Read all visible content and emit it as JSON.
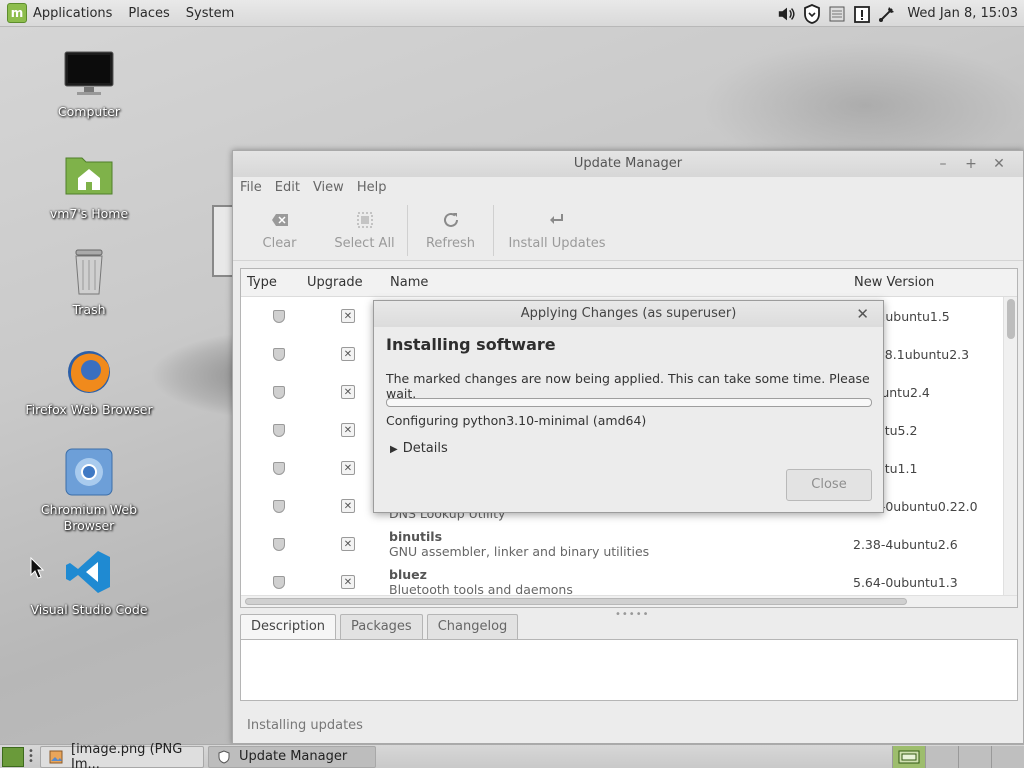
{
  "top_panel": {
    "menus": [
      "Applications",
      "Places",
      "System"
    ],
    "clock": "Wed Jan  8, 15:03",
    "tray_icons": [
      "volume-icon",
      "shield-update-icon",
      "keyboard-icon",
      "notification-icon",
      "network-icon"
    ]
  },
  "desktop": {
    "icons": [
      {
        "label": "Computer",
        "icon": "monitor-icon"
      },
      {
        "label": "vm7's Home",
        "icon": "home-folder-icon"
      },
      {
        "label": "Trash",
        "icon": "trash-icon"
      },
      {
        "label": "Firefox Web Browser",
        "icon": "firefox-icon"
      },
      {
        "label": "Chromium Web Browser",
        "icon": "chromium-icon"
      },
      {
        "label": "Visual Studio Code",
        "icon": "vscode-icon"
      }
    ]
  },
  "window": {
    "title": "Update Manager",
    "menu": [
      "File",
      "Edit",
      "View",
      "Help"
    ],
    "toolbar": {
      "clear": "Clear",
      "select_all": "Select All",
      "refresh": "Refresh",
      "install": "Install Updates"
    },
    "columns": {
      "type": "Type",
      "upgrade": "Upgrade",
      "name": "Name",
      "version": "New Version"
    },
    "rows": [
      {
        "name": "",
        "desc": "",
        "version": "7.5-2ubuntu1.5"
      },
      {
        "name": "",
        "desc": "",
        "version": "91218.1ubuntu2.3"
      },
      {
        "name": "",
        "desc": "",
        "version": "-2ubuntu2.4"
      },
      {
        "name": "",
        "desc": "",
        "version": "ubuntu5.2"
      },
      {
        "name": "",
        "desc": "",
        "version": "ubuntu1.1"
      },
      {
        "name": "",
        "desc": "DNS Lookup Utility",
        "version": "8.28-0ubuntu0.22.0"
      },
      {
        "name": "binutils",
        "desc": "GNU assembler, linker and binary utilities",
        "version": "2.38-4ubuntu2.6"
      },
      {
        "name": "bluez",
        "desc": "Bluetooth tools and daemons",
        "version": "5.64-0ubuntu1.3"
      }
    ],
    "tabs": [
      "Description",
      "Packages",
      "Changelog"
    ],
    "status": "Installing updates"
  },
  "dialog": {
    "title": "Applying Changes (as superuser)",
    "heading": "Installing software",
    "message": "The marked changes are now being applied. This can take some time. Please wait.",
    "progress": 0.0,
    "configuring": "Configuring python3.10-minimal (amd64)",
    "details": "Details",
    "close_button": "Close"
  },
  "taskbar": {
    "tasks": [
      "[image.png (PNG Im...",
      "Update Manager"
    ],
    "workspaces": 4
  },
  "colors": {
    "accent": "#8dbd4d"
  }
}
